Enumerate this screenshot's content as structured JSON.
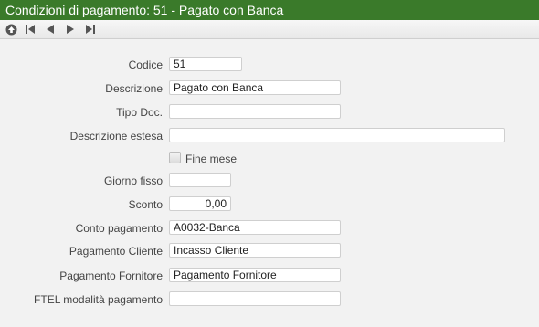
{
  "window": {
    "title": "Condizioni di pagamento: 51 - Pagato con Banca"
  },
  "toolbar": {
    "icons": [
      "up-icon",
      "first-record-icon",
      "previous-record-icon",
      "next-record-icon",
      "last-record-icon"
    ]
  },
  "form": {
    "codice": {
      "label": "Codice",
      "value": "51"
    },
    "descrizione": {
      "label": "Descrizione",
      "value": "Pagato con Banca"
    },
    "tipo_doc": {
      "label": "Tipo Doc.",
      "value": ""
    },
    "descrizione_estesa": {
      "label": "Descrizione estesa",
      "value": ""
    },
    "fine_mese": {
      "label": "Fine mese",
      "checked": false
    },
    "giorno_fisso": {
      "label": "Giorno fisso",
      "value": ""
    },
    "sconto": {
      "label": "Sconto",
      "value": "0,00"
    },
    "conto_pagamento": {
      "label": "Conto pagamento",
      "value": "A0032-Banca"
    },
    "pagamento_cliente": {
      "label": "Pagamento Cliente",
      "value": "Incasso Cliente"
    },
    "pagamento_fornitore": {
      "label": "Pagamento Fornitore",
      "value": "Pagamento Fornitore"
    },
    "ftel_modalita": {
      "label": "FTEL modalità pagamento",
      "value": ""
    }
  },
  "colors": {
    "titlebar": "#3a7a2a",
    "background": "#f2f2f2"
  }
}
